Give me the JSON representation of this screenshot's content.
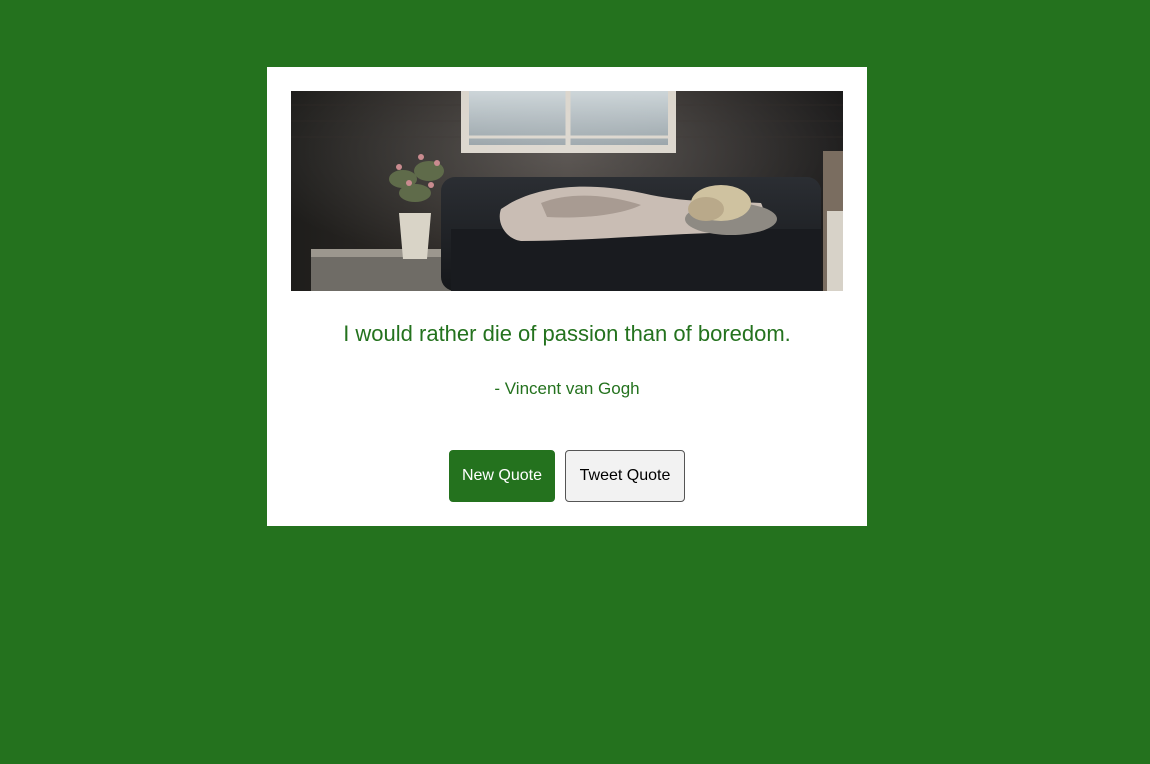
{
  "page": {
    "background_color": "#24721e"
  },
  "quote": {
    "text": "I would rather die of passion than of boredom.",
    "author": "- Vincent van Gogh",
    "text_color": "#24721e",
    "image": "photo of a person lying on a dark sofa beneath a window, with a vase of flowers on a side table"
  },
  "buttons": {
    "new_quote_label": "New Quote",
    "tweet_quote_label": "Tweet Quote",
    "new_quote_color": "#24721e"
  }
}
